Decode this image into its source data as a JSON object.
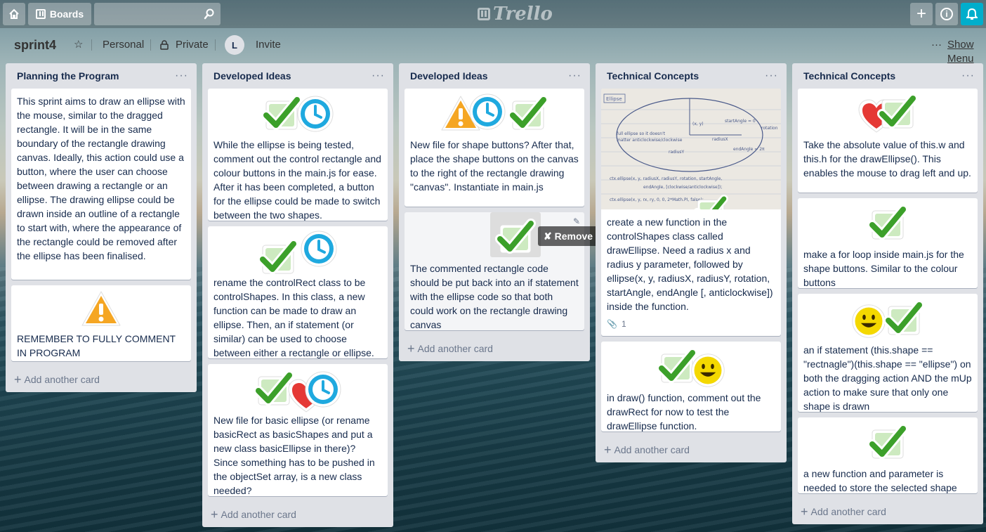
{
  "topbar": {
    "boards_label": "Boards",
    "logo_text": "Trello",
    "search_placeholder": ""
  },
  "board": {
    "name": "sprint4",
    "team": "Personal",
    "visibility": "Private",
    "member_initial": "L",
    "invite_label": "Invite",
    "show_menu_label": "Show Menu"
  },
  "add_card_label": "Add another card",
  "lists": [
    {
      "title": "Planning the Program",
      "cards": [
        {
          "text": "This sprint aims to draw an ellipse with the mouse, similar to the dragged rectangle. It will be in the same boundary of the rectangle drawing canvas. Ideally, this action could use a button, where the user can choose between drawing a rectangle or an ellipse. The drawing ellipse could be drawn inside an outline of a rectangle to start with, where the appearance of the rectangle could be removed after the ellipse has been finalised."
        },
        {
          "text": "REMEMBER TO FULLY COMMENT IN PROGRAM"
        }
      ]
    },
    {
      "title": "Developed Ideas",
      "cards": [
        {
          "text": "While the ellipse is being tested, comment out the control rectangle and colour buttons in the main.js for ease. After it has been completed, a button for the ellipse could be made to switch between the two shapes."
        },
        {
          "text": "rename the controlRect class to be controlShapes. In this class, a new function can be made to draw an ellipse. Then, an if statement (or similar) can be used to choose between either a rectangle or ellipse."
        },
        {
          "text": "New file for basic ellipse (or rename basicRect as basicShapes and put a new class basicEllipse in there)? Since something has to be pushed in the objectSet array, is a new class needed?"
        }
      ]
    },
    {
      "title": "Developed Ideas",
      "cards": [
        {
          "text": "New file for shape buttons? After that, place the shape buttons on the canvas to the right of the rectangle drawing \"canvas\". Instantiate in main.js"
        },
        {
          "text": "The commented rectangle code should be put back into an if statement with the ellipse code so that both could work on the rectangle drawing canvas",
          "remove_label": "Remove"
        }
      ]
    },
    {
      "title": "Technical Concepts",
      "cards": [
        {
          "text": "create a new function in the controlShapes class called drawEllipse. Need a radius x and radius y parameter, followed by ellipse(x, y, radiusX, radiusY, rotation, startAngle, endAngle [, anticlockwise]) inside the function.",
          "attachments": "1",
          "sketch": {
            "tag": "Ellipse",
            "note1": "full ellipse so it doesn't",
            "note2": "matter anticlockwise/clockwise",
            "start": "startAngle = 0",
            "rot": "rotation",
            "end": "endAngle = 2π",
            "rx": "radiusX",
            "ry": "radiusY",
            "xy": "(x, y)",
            "code1": "ctx.ellipse(x, y, radiusX, radiusY, rotation, startAngle,",
            "code2": "endAngle, [clockwise/anticlockwise]);",
            "code3": "ctx.ellipse(x, y, rx, ry, 0, 0, 2*Math.PI, false);"
          }
        },
        {
          "text": "in draw() function, comment out the drawRect for now to test the drawEllipse function."
        }
      ]
    },
    {
      "title": "Technical Concepts",
      "cards": [
        {
          "text": "Take the absolute value of this.w and this.h for the drawEllipse(). This enables the mouse to drag left and up."
        },
        {
          "text": "make a for loop inside main.js for the shape buttons. Similar to the colour buttons"
        },
        {
          "text": "an if statement (this.shape == \"rectnagle\")(this.shape == \"ellipse\") on both the dragging action AND the mUp action to make sure that only one shape is drawn"
        },
        {
          "text": "a new function and parameter is needed to store the selected shape"
        }
      ]
    }
  ],
  "colors": {
    "accent": "#00aecc",
    "check": "#3ca02a",
    "clock": "#1fa9df",
    "warning": "#f5a623",
    "heart": "#e53935",
    "smiley": "#f4d800"
  }
}
